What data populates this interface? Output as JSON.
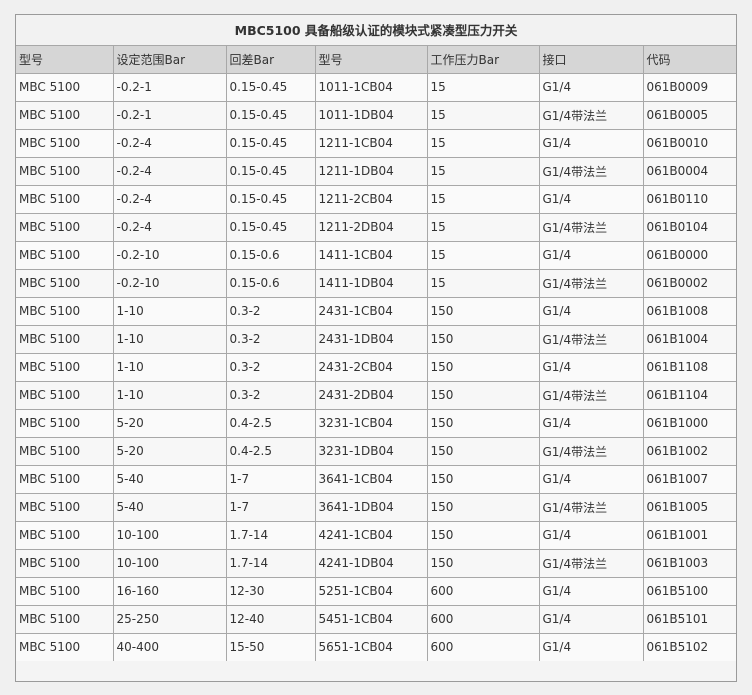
{
  "table": {
    "title": "MBC5100 具备船级认证的模块式紧凑型压力开关",
    "headers": [
      "型号",
      "设定范围Bar",
      "回差Bar",
      "型号",
      "工作压力Bar",
      "接口",
      "代码"
    ],
    "rows": [
      [
        "MBC 5100",
        "-0.2-1",
        "0.15-0.45",
        "1011-1CB04",
        "15",
        "G1/4",
        "061B0009"
      ],
      [
        "MBC 5100",
        "-0.2-1",
        "0.15-0.45",
        "1011-1DB04",
        "15",
        "G1/4带法兰",
        "061B0005"
      ],
      [
        "MBC 5100",
        "-0.2-4",
        "0.15-0.45",
        "1211-1CB04",
        "15",
        "G1/4",
        "061B0010"
      ],
      [
        "MBC 5100",
        "-0.2-4",
        "0.15-0.45",
        "1211-1DB04",
        "15",
        "G1/4带法兰",
        "061B0004"
      ],
      [
        "MBC 5100",
        "-0.2-4",
        "0.15-0.45",
        "1211-2CB04",
        "15",
        "G1/4",
        "061B0110"
      ],
      [
        "MBC 5100",
        "-0.2-4",
        "0.15-0.45",
        "1211-2DB04",
        "15",
        "G1/4带法兰",
        "061B0104"
      ],
      [
        "MBC 5100",
        "-0.2-10",
        "0.15-0.6",
        "1411-1CB04",
        "15",
        "G1/4",
        "061B0000"
      ],
      [
        "MBC 5100",
        "-0.2-10",
        "0.15-0.6",
        "1411-1DB04",
        "15",
        "G1/4带法兰",
        "061B0002"
      ],
      [
        "MBC 5100",
        "1-10",
        "0.3-2",
        "2431-1CB04",
        "150",
        "G1/4",
        "061B1008"
      ],
      [
        "MBC 5100",
        "1-10",
        "0.3-2",
        "2431-1DB04",
        "150",
        "G1/4带法兰",
        "061B1004"
      ],
      [
        "MBC 5100",
        "1-10",
        "0.3-2",
        "2431-2CB04",
        "150",
        "G1/4",
        "061B1108"
      ],
      [
        "MBC 5100",
        "1-10",
        "0.3-2",
        "2431-2DB04",
        "150",
        "G1/4带法兰",
        "061B1104"
      ],
      [
        "MBC 5100",
        "5-20",
        "0.4-2.5",
        "3231-1CB04",
        "150",
        "G1/4",
        "061B1000"
      ],
      [
        "MBC 5100",
        "5-20",
        "0.4-2.5",
        "3231-1DB04",
        "150",
        "G1/4带法兰",
        "061B1002"
      ],
      [
        "MBC 5100",
        "5-40",
        "1-7",
        "3641-1CB04",
        "150",
        "G1/4",
        "061B1007"
      ],
      [
        "MBC 5100",
        "5-40",
        "1-7",
        "3641-1DB04",
        "150",
        "G1/4带法兰",
        "061B1005"
      ],
      [
        "MBC 5100",
        "10-100",
        "1.7-14",
        "4241-1CB04",
        "150",
        "G1/4",
        "061B1001"
      ],
      [
        "MBC 5100",
        "10-100",
        "1.7-14",
        "4241-1DB04",
        "150",
        "G1/4带法兰",
        "061B1003"
      ],
      [
        "MBC 5100",
        "16-160",
        "12-30",
        "5251-1CB04",
        "600",
        "G1/4",
        "061B5100"
      ],
      [
        "MBC 5100",
        "25-250",
        "12-40",
        "5451-1CB04",
        "600",
        "G1/4",
        "061B5101"
      ],
      [
        "MBC 5100",
        "40-400",
        "15-50",
        "5651-1CB04",
        "600",
        "G1/4",
        "061B5102"
      ]
    ]
  }
}
